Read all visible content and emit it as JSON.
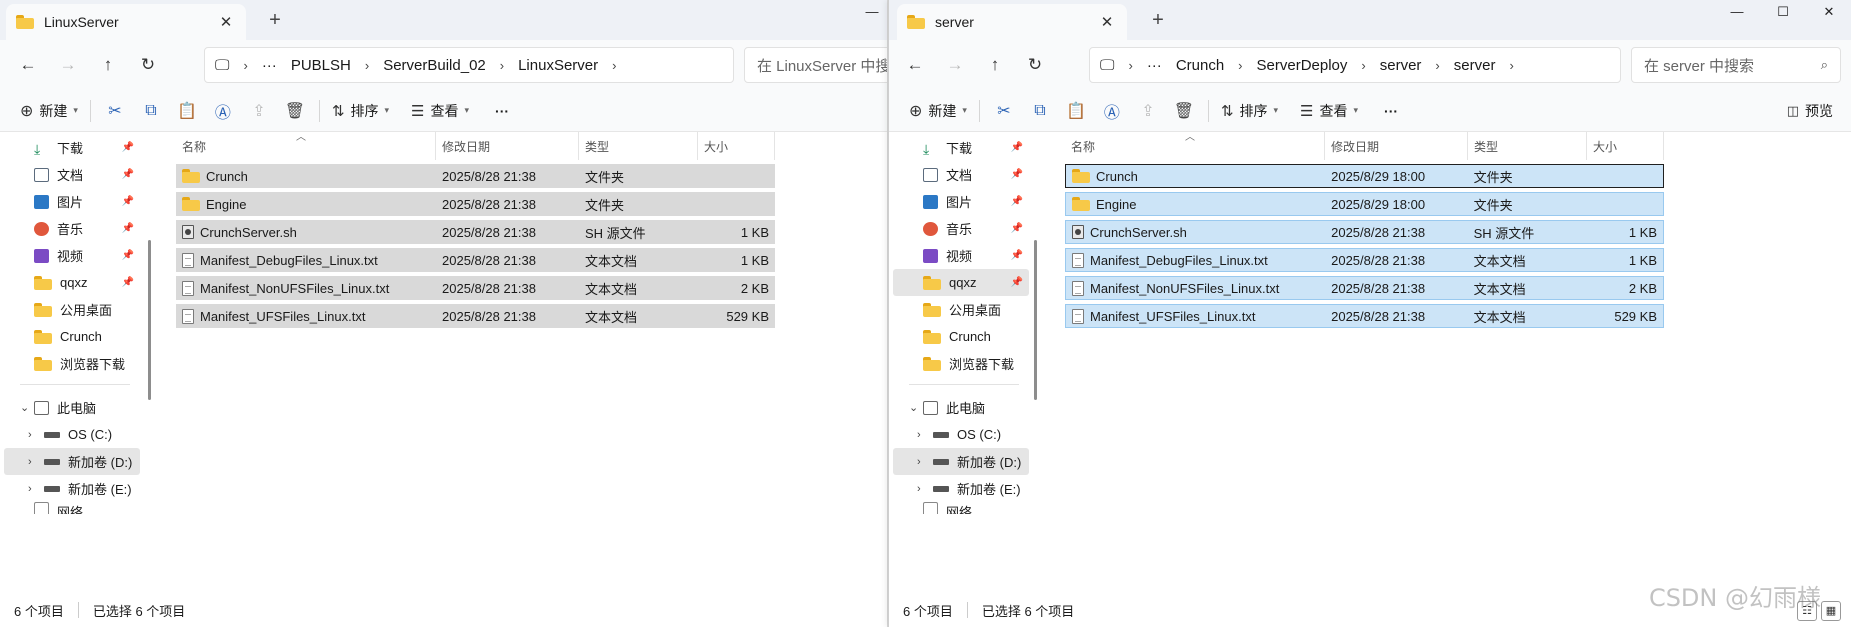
{
  "left": {
    "tab_title": "LinuxServer",
    "path": [
      "PUBLSH",
      "ServerBuild_02",
      "LinuxServer"
    ],
    "search_placeholder": "在 LinuxServer 中搜索",
    "toolbar": {
      "new": "新建",
      "sort": "排序",
      "view": "查看",
      "more": "···"
    },
    "columns": {
      "name": "名称",
      "date": "修改日期",
      "type": "类型",
      "size": "大小"
    },
    "files": [
      {
        "name": "Crunch",
        "date": "2025/8/28 21:38",
        "type": "文件夹",
        "size": "",
        "icon": "folder"
      },
      {
        "name": "Engine",
        "date": "2025/8/28 21:38",
        "type": "文件夹",
        "size": "",
        "icon": "folder"
      },
      {
        "name": "CrunchServer.sh",
        "date": "2025/8/28 21:38",
        "type": "SH 源文件",
        "size": "1 KB",
        "icon": "sh"
      },
      {
        "name": "Manifest_DebugFiles_Linux.txt",
        "date": "2025/8/28 21:38",
        "type": "文本文档",
        "size": "1 KB",
        "icon": "txt"
      },
      {
        "name": "Manifest_NonUFSFiles_Linux.txt",
        "date": "2025/8/28 21:38",
        "type": "文本文档",
        "size": "2 KB",
        "icon": "txt"
      },
      {
        "name": "Manifest_UFSFiles_Linux.txt",
        "date": "2025/8/28 21:38",
        "type": "文本文档",
        "size": "529 KB",
        "icon": "txt"
      }
    ],
    "status": {
      "count": "6 个项目",
      "selected": "已选择 6 个项目"
    }
  },
  "right": {
    "tab_title": "server",
    "path": [
      "Crunch",
      "ServerDeploy",
      "server",
      "server"
    ],
    "search_placeholder": "在 server 中搜索",
    "toolbar": {
      "new": "新建",
      "sort": "排序",
      "view": "查看",
      "more": "···",
      "preview": "预览"
    },
    "columns": {
      "name": "名称",
      "date": "修改日期",
      "type": "类型",
      "size": "大小"
    },
    "files": [
      {
        "name": "Crunch",
        "date": "2025/8/29 18:00",
        "type": "文件夹",
        "size": "",
        "icon": "folder"
      },
      {
        "name": "Engine",
        "date": "2025/8/29 18:00",
        "type": "文件夹",
        "size": "",
        "icon": "folder"
      },
      {
        "name": "CrunchServer.sh",
        "date": "2025/8/28 21:38",
        "type": "SH 源文件",
        "size": "1 KB",
        "icon": "sh"
      },
      {
        "name": "Manifest_DebugFiles_Linux.txt",
        "date": "2025/8/28 21:38",
        "type": "文本文档",
        "size": "1 KB",
        "icon": "txt"
      },
      {
        "name": "Manifest_NonUFSFiles_Linux.txt",
        "date": "2025/8/28 21:38",
        "type": "文本文档",
        "size": "2 KB",
        "icon": "txt"
      },
      {
        "name": "Manifest_UFSFiles_Linux.txt",
        "date": "2025/8/28 21:38",
        "type": "文本文档",
        "size": "529 KB",
        "icon": "txt"
      }
    ],
    "status": {
      "count": "6 个项目",
      "selected": "已选择 6 个项目"
    }
  },
  "sidebar": {
    "quick": [
      {
        "label": "下载",
        "icon": "download-icon",
        "color": "#1a8a5a"
      },
      {
        "label": "文档",
        "icon": "document-icon",
        "color": "#5b6b7d"
      },
      {
        "label": "图片",
        "icon": "picture-icon",
        "color": "#2b78c5"
      },
      {
        "label": "音乐",
        "icon": "music-icon",
        "color": "#e0573c"
      },
      {
        "label": "视频",
        "icon": "video-icon",
        "color": "#7b4bc4"
      },
      {
        "label": "qqxz",
        "icon": "folder-icon",
        "color": "#f7c948"
      },
      {
        "label": "公用桌面",
        "icon": "folder-icon",
        "color": "#f7c948"
      },
      {
        "label": "Crunch",
        "icon": "folder-icon",
        "color": "#f7c948"
      },
      {
        "label": "浏览器下载",
        "icon": "folder-icon",
        "color": "#f7c948"
      }
    ],
    "this_pc": "此电脑",
    "drives": [
      "OS (C:)",
      "新加卷 (D:)",
      "新加卷 (E:)"
    ],
    "cut_off_item": "网络"
  },
  "watermark": "CSDN @幻雨様"
}
